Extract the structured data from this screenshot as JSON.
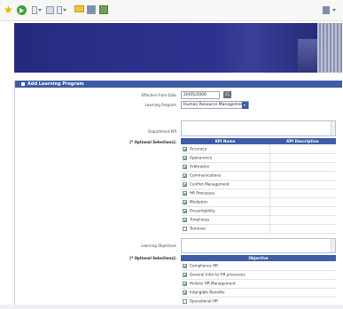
{
  "form": {
    "title": "Add Learning Program",
    "effective_from_label": "Effective From Date",
    "effective_from_value": "20/05/2006",
    "learning_program_label": "Learning Program",
    "learning_program_value": "Human Resource Management",
    "department_kpi_label": "Department KPI",
    "optional_selections_label": "[* Optional Selections]:",
    "learning_objectives_label": "Learning Objectives",
    "optional_selections_label_2": "[* Optional Selections]:"
  },
  "kpi_table": {
    "headers": [
      "KPI Name",
      "KPI Description"
    ],
    "rows": [
      {
        "name": "Accuracy",
        "checked": true
      },
      {
        "name": "Appearance",
        "checked": true
      },
      {
        "name": "Arbitration",
        "checked": true
      },
      {
        "name": "Communications",
        "checked": true
      },
      {
        "name": "Conflict Management",
        "checked": true
      },
      {
        "name": "HR Processes",
        "checked": true
      },
      {
        "name": "Mediation",
        "checked": true
      },
      {
        "name": "Presentability",
        "checked": true
      },
      {
        "name": "Timeliness",
        "checked": true
      },
      {
        "name": "Turnover",
        "checked": false
      }
    ]
  },
  "objective_table": {
    "header": "Objective",
    "rows": [
      {
        "name": "Compliance HR",
        "checked": true
      },
      {
        "name": "General Intro to HR processes",
        "checked": true
      },
      {
        "name": "Holistic HR Management",
        "checked": true
      },
      {
        "name": "Intangible Benefits",
        "checked": true
      },
      {
        "name": "Operational HR",
        "checked": false
      }
    ]
  },
  "colors": {
    "header_blue": "#3e5da6",
    "banner_blue": "#2a2e86"
  }
}
